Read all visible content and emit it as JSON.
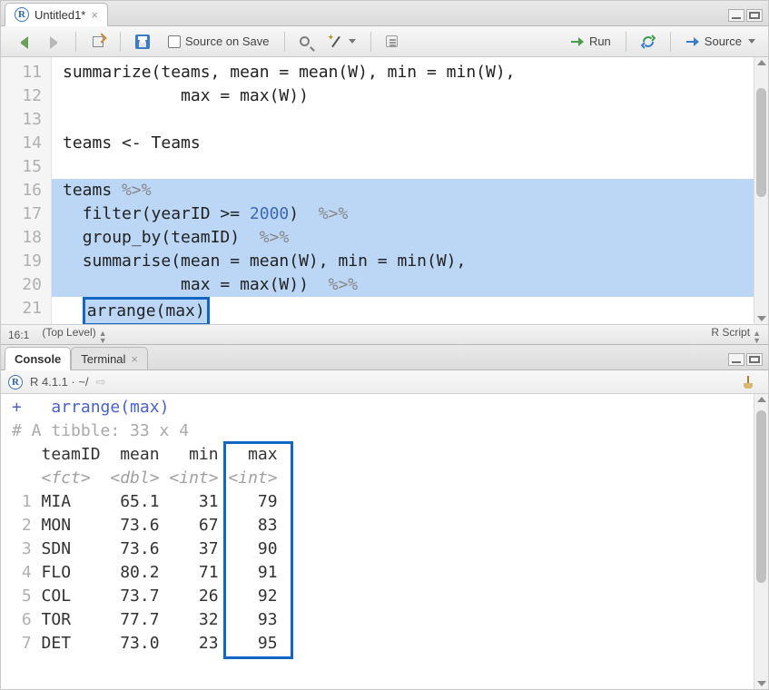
{
  "editor": {
    "tab_title": "Untitled1*",
    "toolbar": {
      "source_on_save": "Source on Save",
      "run": "Run",
      "source": "Source"
    },
    "gutter_lines": [
      "11",
      "12",
      "13",
      "14",
      "15",
      "16",
      "17",
      "18",
      "19",
      "20",
      "21"
    ],
    "code_plain": {
      "l11": "summarize(teams, mean = mean(W), min = min(W),",
      "l12": "            max = max(W))",
      "l13": "",
      "l14": "teams <- Teams",
      "l15": ""
    },
    "code_sel": {
      "l16_a": "teams ",
      "l16_b": "%>%",
      "l17_pad": "  ",
      "l17_a": "filter(yearID >= ",
      "l17_num": "2000",
      "l17_b": ")  ",
      "l17_c": "%>%",
      "l18_pad": "  ",
      "l18_a": "group_by(teamID)  ",
      "l18_b": "%>%",
      "l19_pad": "  ",
      "l19_a": "summarise(mean = mean(W), min = min(W),",
      "l20_pad": "            ",
      "l20_a": "max = max(W))  ",
      "l20_b": "%>%"
    },
    "code_box": "arrange(max)",
    "status": {
      "pos": "16:1",
      "scope": "(Top Level)",
      "type": "R Script"
    }
  },
  "console": {
    "tabs": {
      "console": "Console",
      "terminal": "Terminal"
    },
    "info": "R 4.1.1 · ~/",
    "echo_prefix": "+   ",
    "echo_cmd": "arrange(max)",
    "tibble_header": "# A tibble: 33 x 4",
    "colnames": "   teamID  mean   min   max",
    "coltypes": "   <fct>  <dbl> <int> <int>",
    "rows": [
      {
        "idx": "1",
        "team": "MIA",
        "mean": "65.1",
        "min": "31",
        "max": "79"
      },
      {
        "idx": "2",
        "team": "MON",
        "mean": "73.6",
        "min": "67",
        "max": "83"
      },
      {
        "idx": "3",
        "team": "SDN",
        "mean": "73.6",
        "min": "37",
        "max": "90"
      },
      {
        "idx": "4",
        "team": "FLO",
        "mean": "80.2",
        "min": "71",
        "max": "91"
      },
      {
        "idx": "5",
        "team": "COL",
        "mean": "73.7",
        "min": "26",
        "max": "92"
      },
      {
        "idx": "6",
        "team": "TOR",
        "mean": "77.7",
        "min": "32",
        "max": "93"
      },
      {
        "idx": "7",
        "team": "DET",
        "mean": "73.0",
        "min": "23",
        "max": "95"
      }
    ]
  }
}
